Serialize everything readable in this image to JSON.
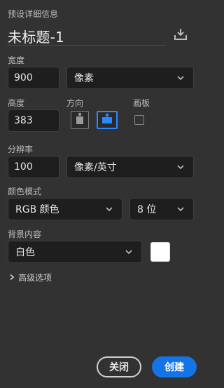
{
  "preset_details": {
    "label": "预设详细信息",
    "name": "未标题-1"
  },
  "width": {
    "label": "宽度",
    "value": "900",
    "unit": "像素"
  },
  "height": {
    "label": "高度",
    "value": "383"
  },
  "orientation": {
    "label": "方向",
    "selected": "landscape"
  },
  "artboard": {
    "label": "画板",
    "checked": false
  },
  "resolution": {
    "label": "分辨率",
    "value": "100",
    "unit": "像素/英寸"
  },
  "color_mode": {
    "label": "颜色模式",
    "mode": "RGB 颜色",
    "depth": "8 位"
  },
  "background": {
    "label": "背景内容",
    "value": "白色",
    "swatch_color": "#ffffff"
  },
  "advanced": {
    "label": "高级选项"
  },
  "buttons": {
    "close": "关闭",
    "create": "创建"
  },
  "colors": {
    "accent": "#1473e6",
    "orientation_active_border": "#2b88ff"
  },
  "icons": {
    "save_preset": "save-preset-icon",
    "chevron": "chevron-down-icon",
    "portrait": "portrait-orientation-icon",
    "landscape": "landscape-orientation-icon",
    "advanced": "chevron-right-icon"
  }
}
